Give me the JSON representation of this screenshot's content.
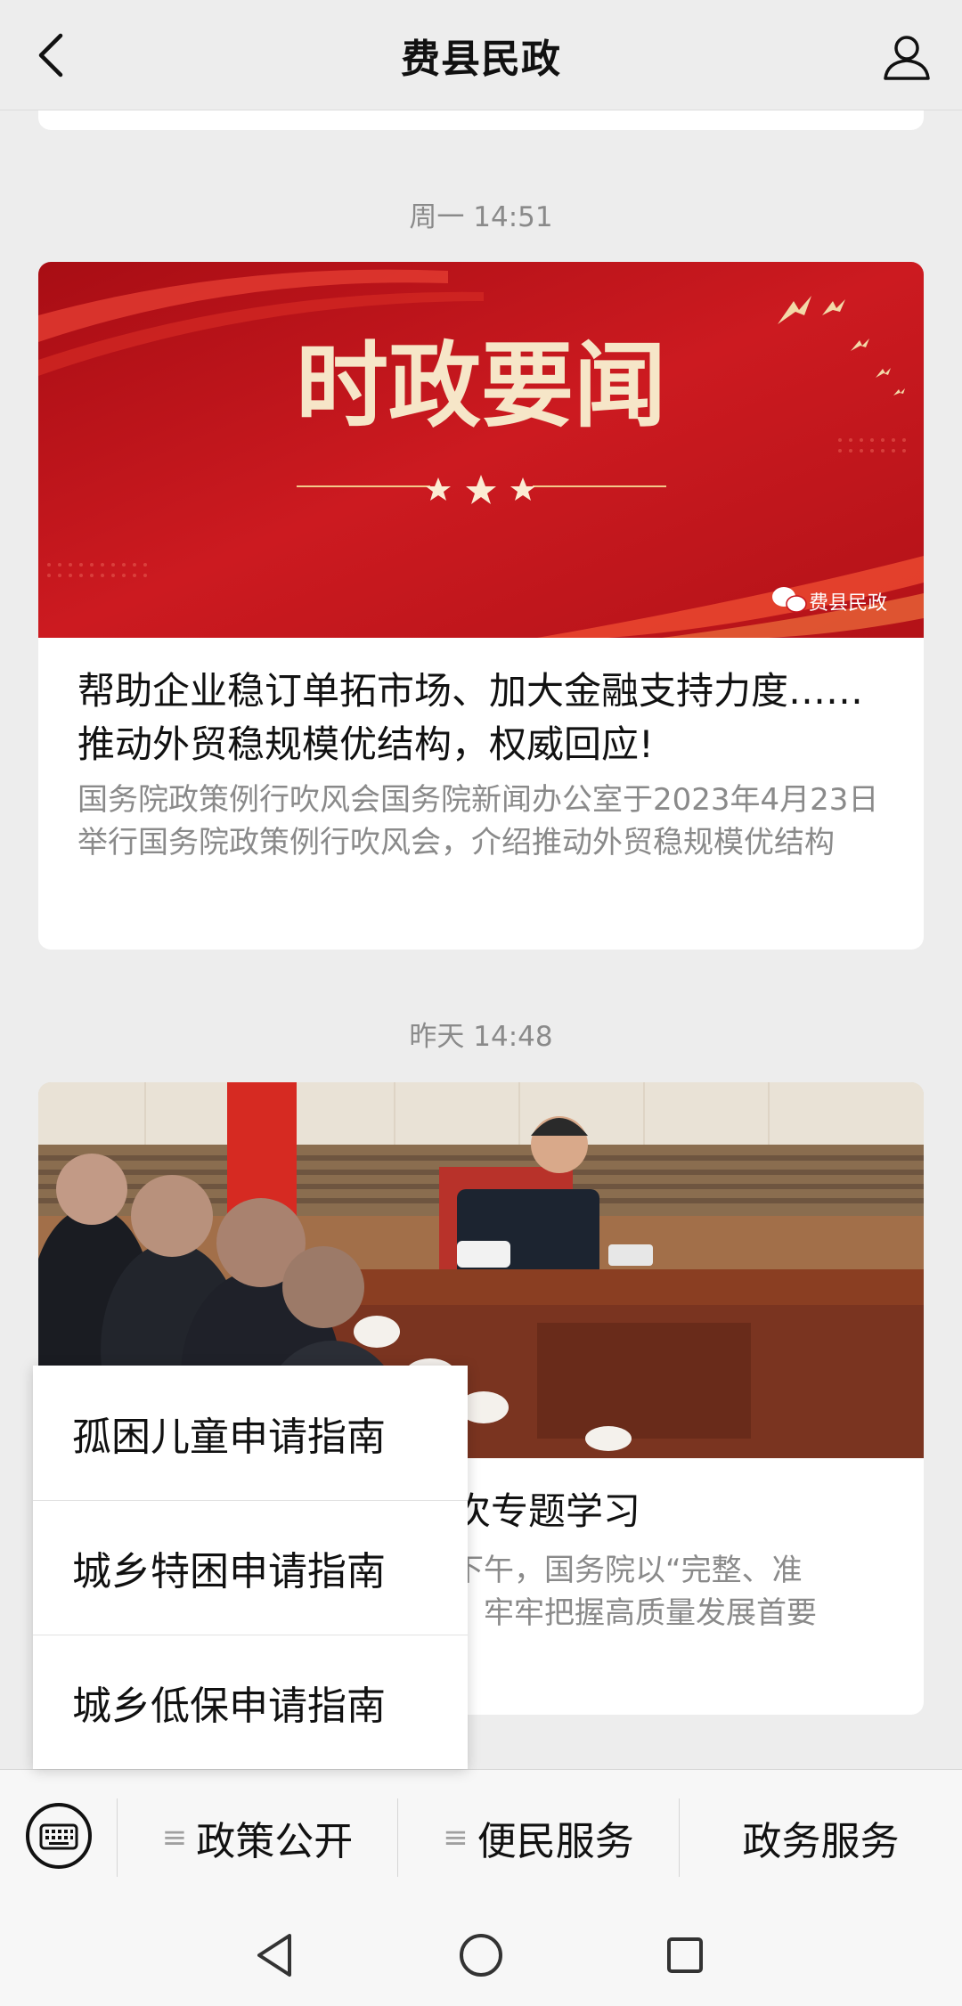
{
  "header": {
    "title": "费县民政",
    "back_icon": "chevron-left-icon",
    "profile_icon": "person-icon"
  },
  "messages": [
    {
      "timestamp": "周一 14:51",
      "cover": {
        "headline": "时政要闻",
        "watermark": "费县民政",
        "colors": {
          "background": "#c8161e",
          "text": "#f6e6c8"
        }
      },
      "title": "帮助企业稳订单拓市场、加大金融支持力度……推动外贸稳规模优结构，权威回应!",
      "description": "国务院政策例行吹风会国务院新闻办公室于2023年4月23日举行国务院政策例行吹风会，介绍推动外贸稳规模优结构"
    },
    {
      "timestamp": "昨天 14:48",
      "cover": {
        "subject": "meeting-photo"
      },
      "title_visible": "次专题学习",
      "description_visible": [
        "下午，国务院以“完整、准",
        "，牢牢把握高质量发展首要"
      ]
    }
  ],
  "popup_menu": {
    "items": [
      {
        "label": "孤困儿童申请指南"
      },
      {
        "label": "城乡特困申请指南"
      },
      {
        "label": "城乡低保申请指南"
      }
    ]
  },
  "menubar": {
    "keyboard_icon": "keyboard-icon",
    "items": [
      {
        "label": "政策公开",
        "has_submenu": true
      },
      {
        "label": "便民服务",
        "has_submenu": true
      },
      {
        "label": "政务服务",
        "has_submenu": false
      }
    ]
  },
  "system_nav": {
    "buttons": [
      "back-triangle-icon",
      "home-circle-icon",
      "recents-square-icon"
    ]
  }
}
